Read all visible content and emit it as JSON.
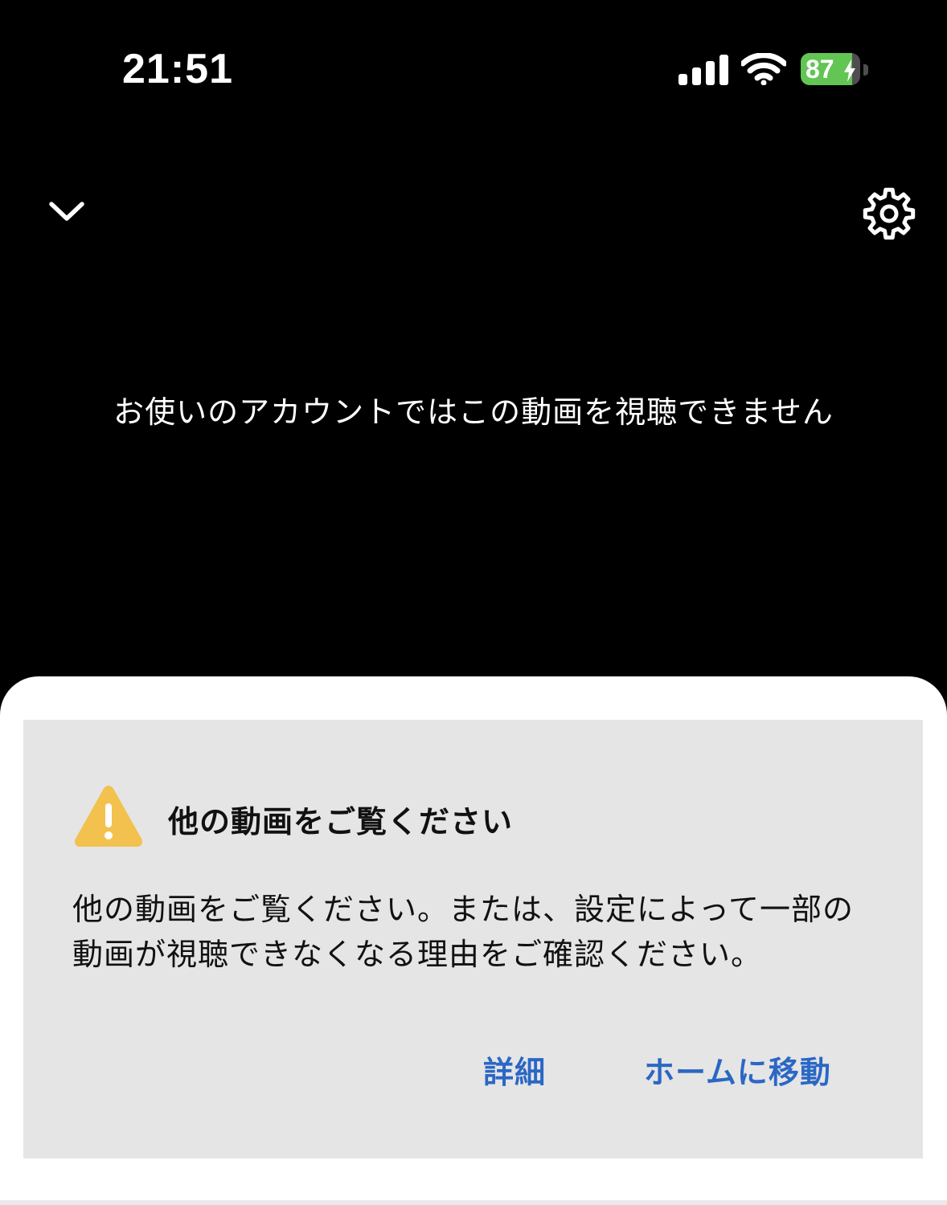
{
  "status_bar": {
    "time": "21:51",
    "battery_percent": "87",
    "battery_level": 0.87,
    "charging": true,
    "icons": [
      "signal-icon",
      "wifi-icon",
      "battery-icon",
      "bolt-icon"
    ]
  },
  "player": {
    "collapse_icon": "chevron-down-icon",
    "settings_icon": "gear-icon",
    "message": "お使いのアカウントではこの動画を視聴できません"
  },
  "notice": {
    "icon": "warning-icon",
    "icon_color": "#f2c14e",
    "title": "他の動画をご覧ください",
    "body_line1": "他の動画をご覧ください。または、設定によって一部の",
    "body_line2": "動画が視聴できなくなる理由をご確認ください。",
    "actions": {
      "details": "詳細",
      "go_home": "ホームに移動"
    },
    "action_color": "#2b67c4"
  }
}
